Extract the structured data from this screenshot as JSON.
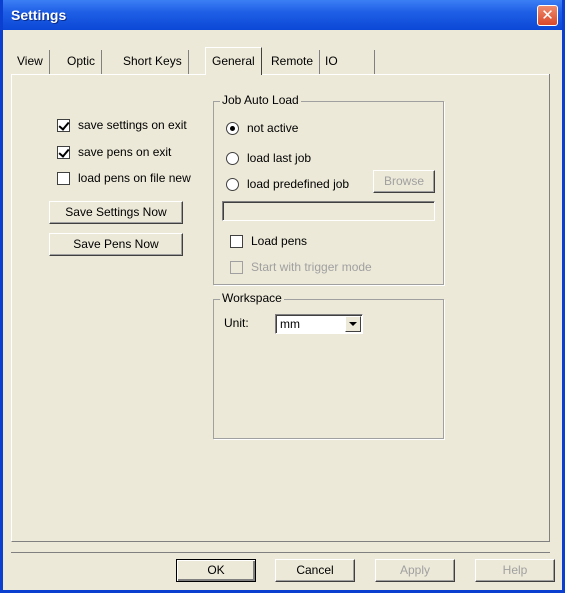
{
  "window": {
    "title": "Settings"
  },
  "tabs": [
    {
      "label": "View"
    },
    {
      "label": "Optic"
    },
    {
      "label": "Short Keys"
    },
    {
      "label": "General",
      "active": true
    },
    {
      "label": "Remote"
    },
    {
      "label": "IO"
    }
  ],
  "general": {
    "save_settings_on_exit": {
      "label": "save settings on exit",
      "checked": true
    },
    "save_pens_on_exit": {
      "label": "save pens on exit",
      "checked": true
    },
    "load_pens_on_file_new": {
      "label": "load pens on file new",
      "checked": false
    },
    "save_settings_now_label": "Save Settings Now",
    "save_pens_now_label": "Save Pens Now"
  },
  "job_auto_load": {
    "title": "Job Auto Load",
    "options": [
      {
        "label": "not active",
        "checked": true
      },
      {
        "label": "load last job",
        "checked": false
      },
      {
        "label": "load predefined job",
        "checked": false
      }
    ],
    "browse_label": "Browse",
    "path_value": "",
    "load_pens": {
      "label": "Load pens",
      "checked": false
    },
    "start_trigger": {
      "label": "Start with trigger mode",
      "checked": false,
      "disabled": true
    }
  },
  "workspace": {
    "title": "Workspace",
    "unit_label": "Unit:",
    "unit_value": "mm"
  },
  "footer": {
    "ok_label": "OK",
    "cancel_label": "Cancel",
    "apply_label": "Apply",
    "help_label": "Help"
  },
  "colors": {
    "titlebar": "#0b48d6",
    "close_button": "#d9482a",
    "dialog_bg": "#ece9d8"
  }
}
